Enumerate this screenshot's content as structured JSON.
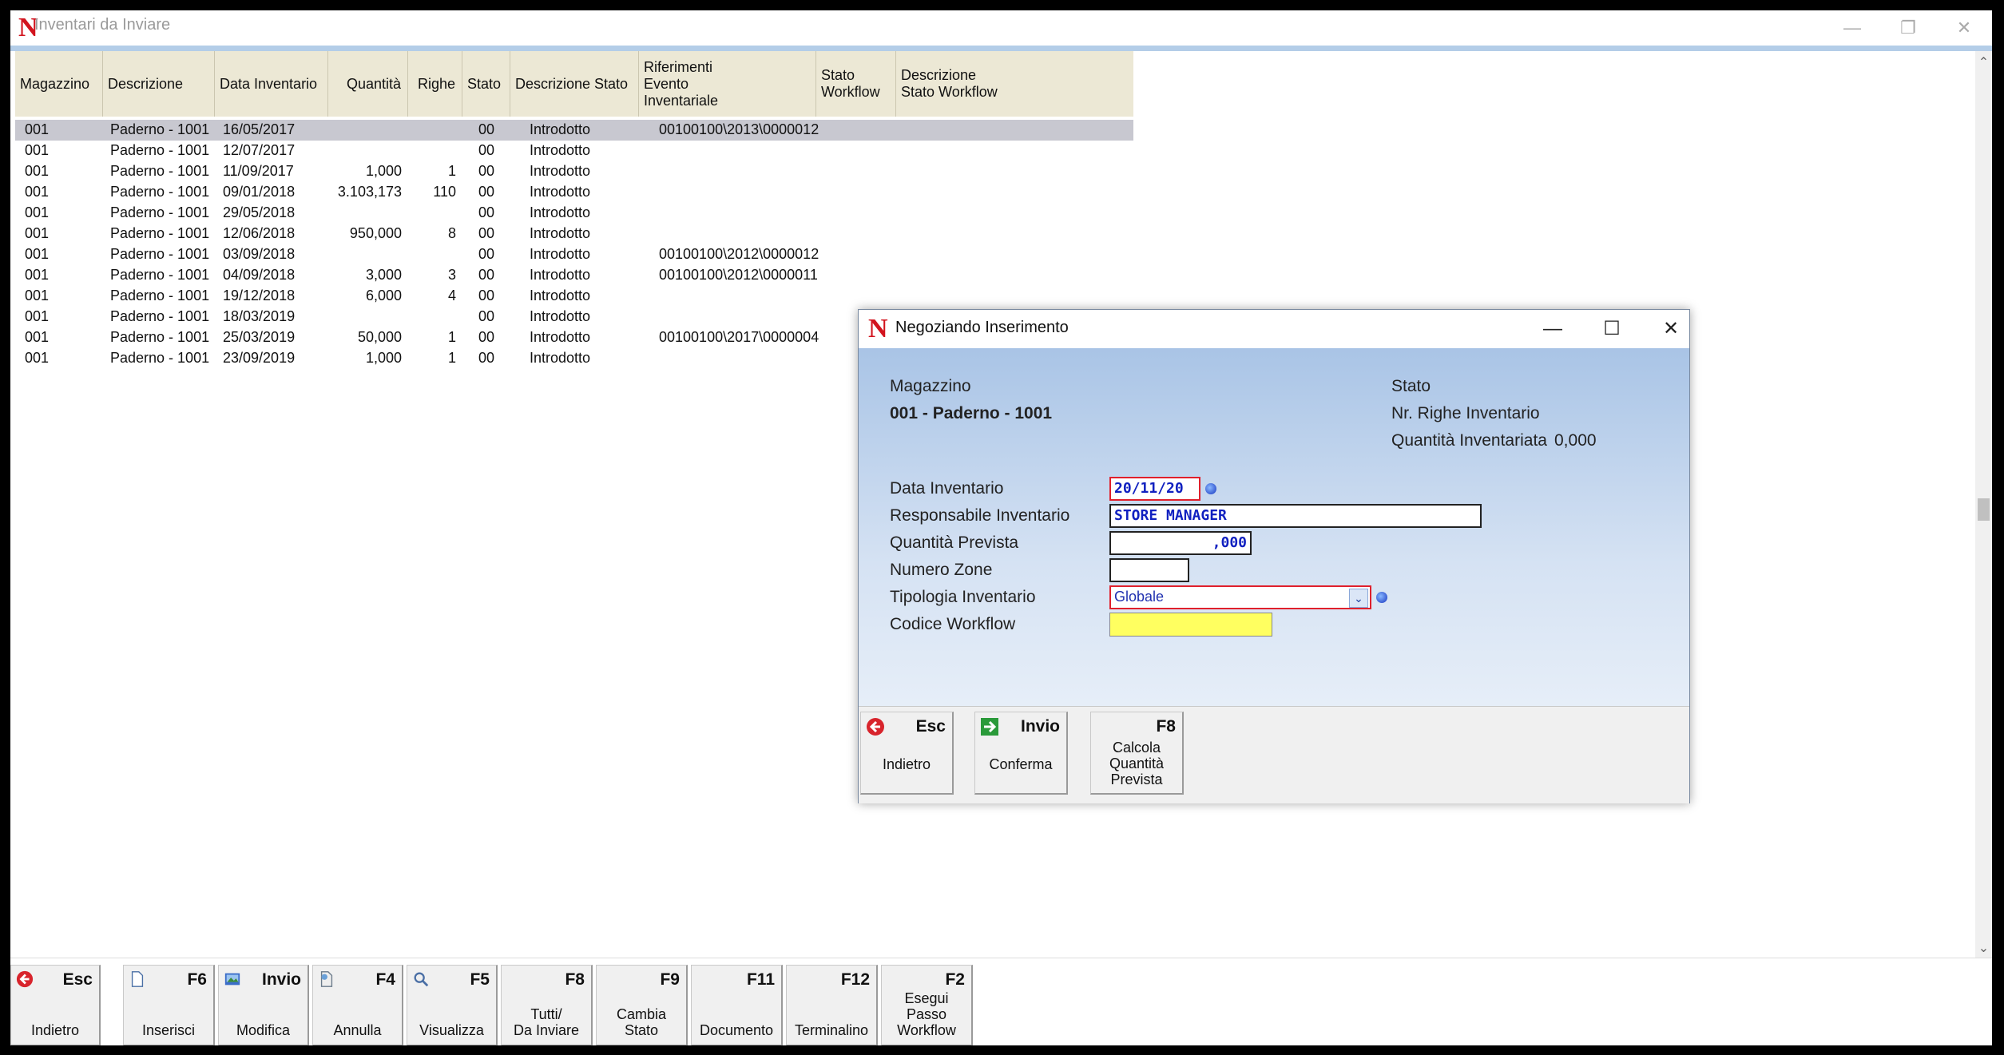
{
  "window": {
    "title": "Inventari da Inviare",
    "logo": "N"
  },
  "grid": {
    "columns": [
      "Magazzino",
      "Descrizione",
      "Data Inventario",
      "Quantità",
      "Righe",
      "Stato",
      "Descrizione Stato",
      "Riferimenti Evento Inventariale",
      "Stato Workflow",
      "Descrizione Stato Workflow"
    ],
    "column_lines": {
      "ref": [
        "Riferimenti",
        "Evento",
        "Inventariale"
      ],
      "sw": [
        "Stato",
        "Workflow"
      ],
      "dsw": [
        "Descrizione",
        "Stato Workflow"
      ]
    },
    "rows": [
      {
        "mag": "001",
        "desc": "Paderno - 1001",
        "date": "16/05/2017",
        "qty": "",
        "righe": "",
        "stato": "00",
        "dstato": "Introdotto",
        "ref": "00100100\\2013\\0000012"
      },
      {
        "mag": "001",
        "desc": "Paderno - 1001",
        "date": "12/07/2017",
        "qty": "",
        "righe": "",
        "stato": "00",
        "dstato": "Introdotto",
        "ref": ""
      },
      {
        "mag": "001",
        "desc": "Paderno - 1001",
        "date": "11/09/2017",
        "qty": "1,000",
        "righe": "1",
        "stato": "00",
        "dstato": "Introdotto",
        "ref": ""
      },
      {
        "mag": "001",
        "desc": "Paderno - 1001",
        "date": "09/01/2018",
        "qty": "3.103,173",
        "righe": "110",
        "stato": "00",
        "dstato": "Introdotto",
        "ref": ""
      },
      {
        "mag": "001",
        "desc": "Paderno - 1001",
        "date": "29/05/2018",
        "qty": "",
        "righe": "",
        "stato": "00",
        "dstato": "Introdotto",
        "ref": ""
      },
      {
        "mag": "001",
        "desc": "Paderno - 1001",
        "date": "12/06/2018",
        "qty": "950,000",
        "righe": "8",
        "stato": "00",
        "dstato": "Introdotto",
        "ref": ""
      },
      {
        "mag": "001",
        "desc": "Paderno - 1001",
        "date": "03/09/2018",
        "qty": "",
        "righe": "",
        "stato": "00",
        "dstato": "Introdotto",
        "ref": "00100100\\2012\\0000012"
      },
      {
        "mag": "001",
        "desc": "Paderno - 1001",
        "date": "04/09/2018",
        "qty": "3,000",
        "righe": "3",
        "stato": "00",
        "dstato": "Introdotto",
        "ref": "00100100\\2012\\0000011"
      },
      {
        "mag": "001",
        "desc": "Paderno - 1001",
        "date": "19/12/2018",
        "qty": "6,000",
        "righe": "4",
        "stato": "00",
        "dstato": "Introdotto",
        "ref": ""
      },
      {
        "mag": "001",
        "desc": "Paderno - 1001",
        "date": "18/03/2019",
        "qty": "",
        "righe": "",
        "stato": "00",
        "dstato": "Introdotto",
        "ref": ""
      },
      {
        "mag": "001",
        "desc": "Paderno - 1001",
        "date": "25/03/2019",
        "qty": "50,000",
        "righe": "1",
        "stato": "00",
        "dstato": "Introdotto",
        "ref": "00100100\\2017\\0000004"
      },
      {
        "mag": "001",
        "desc": "Paderno - 1001",
        "date": "23/09/2019",
        "qty": "1,000",
        "righe": "1",
        "stato": "00",
        "dstato": "Introdotto",
        "ref": ""
      }
    ]
  },
  "toolbar": [
    {
      "key": "Esc",
      "label": "Indietro",
      "icon": "back-arrow-icon"
    },
    {
      "key": "F6",
      "label": "Inserisci",
      "icon": "new-document-icon"
    },
    {
      "key": "Invio",
      "label": "Modifica",
      "icon": "edit-picture-icon"
    },
    {
      "key": "F4",
      "label": "Annulla",
      "icon": "cancel-document-icon"
    },
    {
      "key": "F5",
      "label": "Visualizza",
      "icon": "magnifier-icon"
    },
    {
      "key": "F8",
      "label": "Tutti/\nDa Inviare",
      "icon": ""
    },
    {
      "key": "F9",
      "label": "Cambia\nStato",
      "icon": ""
    },
    {
      "key": "F11",
      "label": "Documento",
      "icon": ""
    },
    {
      "key": "F12",
      "label": "Terminalino",
      "icon": ""
    },
    {
      "key": "F2",
      "label": "Esegui\nPasso\nWorkflow",
      "icon": ""
    }
  ],
  "dialog": {
    "title": "Negoziando  Inserimento",
    "magazzino_label": "Magazzino",
    "magazzino_value": "001 - Paderno - 1001",
    "stato_label": "Stato",
    "righe_label": "Nr. Righe Inventario",
    "quantita_inv_label": "Quantità Inventariata",
    "quantita_inv_value": "0,000",
    "fields": {
      "data_label": "Data Inventario",
      "data_value": "20/11/20",
      "resp_label": "Responsabile Inventario",
      "resp_value": "STORE MANAGER",
      "qprev_label": "Quantità Prevista",
      "qprev_value": ",000",
      "zone_label": "Numero Zone",
      "zone_value": "",
      "tipo_label": "Tipologia Inventario",
      "tipo_value": "Globale",
      "wf_label": "Codice Workflow",
      "wf_value": ""
    },
    "buttons": {
      "esc_key": "Esc",
      "esc_label": "Indietro",
      "invio_key": "Invio",
      "invio_label": "Conferma",
      "f8_key": "F8",
      "f8_label": "Calcola\nQuantità\nPrevista"
    }
  },
  "colors": {
    "accent_red": "#d2141e",
    "header_bg": "#ece8d5",
    "selected_row": "#c8c8d0",
    "dialog_gradient_top": "#a9c4e6",
    "workflow_field": "#ffff60"
  }
}
